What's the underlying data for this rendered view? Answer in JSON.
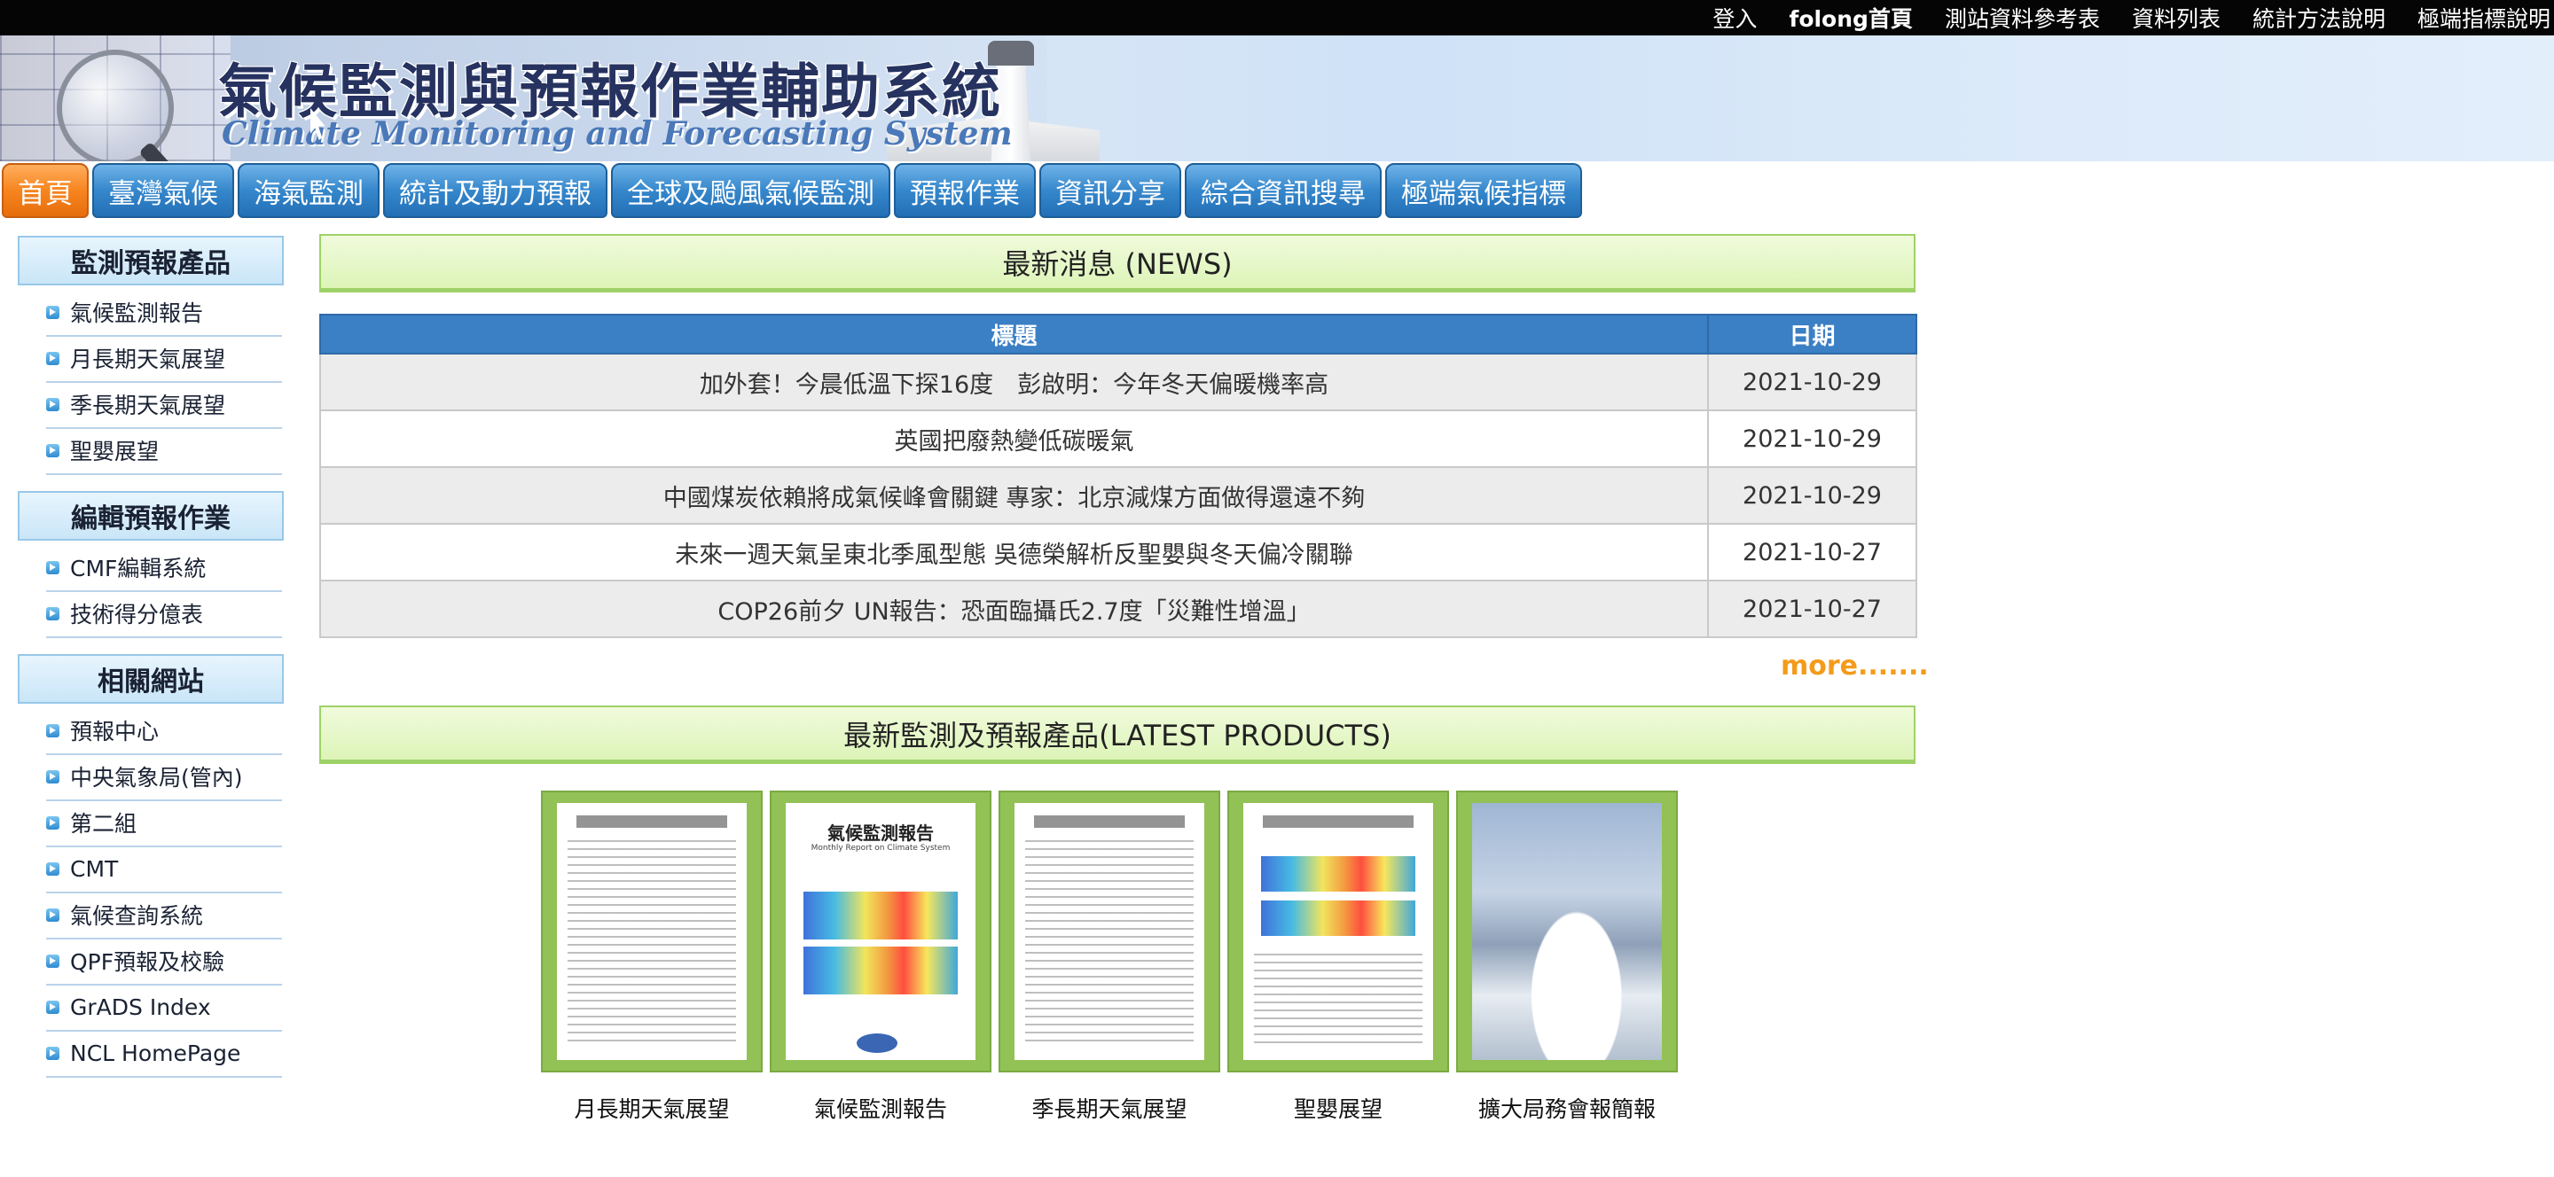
{
  "toplinks": {
    "login": "登入",
    "folong_home": "folong首頁",
    "station_ref": "測站資料參考表",
    "data_list": "資料列表",
    "stat_method": "統計方法說明",
    "extreme_index": "極端指標說明"
  },
  "banner": {
    "title": "氣候監測與預報作業輔助系統",
    "subtitle": "Climate Monitoring and Forecasting System"
  },
  "nav": {
    "tabs": [
      "首頁",
      "臺灣氣候",
      "海氣監測",
      "統計及動力預報",
      "全球及颱風氣候監測",
      "預報作業",
      "資訊分享",
      "綜合資訊搜尋",
      "極端氣候指標"
    ],
    "active_index": 0
  },
  "sidebar": {
    "sections": [
      {
        "title": "監測預報產品",
        "items": [
          "氣候監測報告",
          "月長期天氣展望",
          "季長期天氣展望",
          "聖嬰展望"
        ]
      },
      {
        "title": "編輯預報作業",
        "items": [
          "CMF編輯系統",
          "技術得分億表"
        ]
      },
      {
        "title": "相關網站",
        "items": [
          "預報中心",
          "中央氣象局(管內)",
          "第二組",
          "CMT",
          "氣候查詢系統",
          "QPF預報及校驗",
          "GrADS Index",
          "NCL HomePage"
        ]
      }
    ]
  },
  "news": {
    "heading": "最新消息 (NEWS)",
    "columns": [
      "標題",
      "日期"
    ],
    "rows": [
      {
        "title": "加外套！今晨低溫下探16度　彭啟明：今年冬天偏暖機率高",
        "date": "2021-10-29"
      },
      {
        "title": "英國把廢熱變低碳暖氣",
        "date": "2021-10-29"
      },
      {
        "title": "中國煤炭依賴將成氣候峰會關鍵 專家：北京減煤方面做得還遠不夠",
        "date": "2021-10-29"
      },
      {
        "title": "未來一週天氣呈東北季風型態 吳德榮解析反聖嬰與冬天偏冷關聯",
        "date": "2021-10-27"
      },
      {
        "title": "COP26前夕 UN報告：恐面臨攝氏2.7度「災難性增溫」",
        "date": "2021-10-27"
      }
    ],
    "more": "more......."
  },
  "products": {
    "heading": "最新監測及預報產品(LATEST PRODUCTS)",
    "items": [
      {
        "label": "月長期天氣展望",
        "icon": "report-document-icon"
      },
      {
        "label": "氣候監測報告",
        "icon": "climate-report-cover-icon",
        "cover_title": "氣候監測報告",
        "cover_subtitle": "Monthly Report on Climate System"
      },
      {
        "label": "季長期天氣展望",
        "icon": "report-document-icon"
      },
      {
        "label": "聖嬰展望",
        "icon": "enso-report-icon"
      },
      {
        "label": "擴大局務會報簡報",
        "icon": "briefing-cover-icon"
      }
    ]
  },
  "colors": {
    "nav_blue": "#3587cc",
    "nav_active_orange": "#f7851f",
    "table_header": "#3b7fc4",
    "section_green": "#ddf4b8",
    "more_orange": "#f49b1a"
  }
}
